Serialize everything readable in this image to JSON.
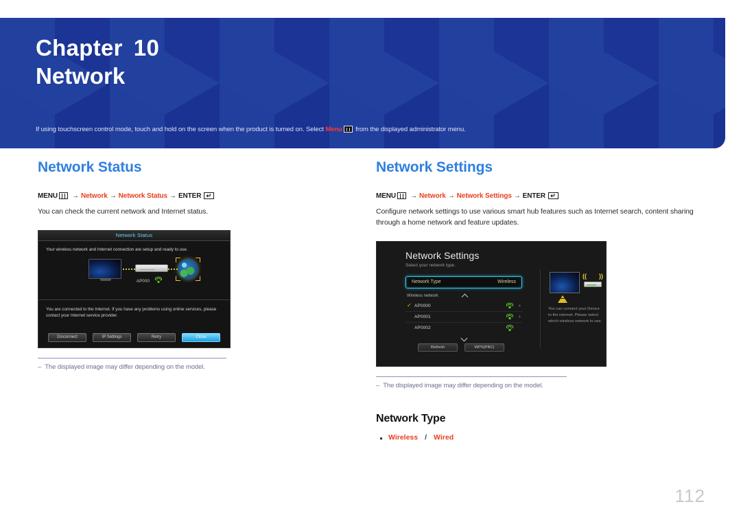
{
  "banner": {
    "chapter_word": "Chapter",
    "chapter_number": "10",
    "chapter_title": "Network",
    "note_before": "If using touchscreen control mode, touch and hold on the screen when the product is turned on. Select ",
    "note_keyword": "Menu",
    "note_after": " from the displayed administrator menu.",
    "bg_color": "#1f3a9e"
  },
  "left_section": {
    "title": "Network Status",
    "menu_path": {
      "menu_label": "MENU",
      "arrow": "→",
      "step1": "Network",
      "step2": "Network Status",
      "enter_label": "ENTER"
    },
    "description": "You can check the current network and Internet status.",
    "caption_dash": "–",
    "caption": "The displayed image may differ depending on the model.",
    "screenshot": {
      "title": "Network Status",
      "status_line": "Your wireless network and Internet connection are setup and ready to use.",
      "ap_label": "AP000",
      "message": "You are connected to the Internet. If you have any problems using online services, please contact your Internet service provider.",
      "buttons": [
        {
          "label": "Disconnect",
          "primary": false
        },
        {
          "label": "IP Settings",
          "primary": false
        },
        {
          "label": "Retry",
          "primary": false
        },
        {
          "label": "Close",
          "primary": true
        }
      ]
    }
  },
  "right_section": {
    "title": "Network Settings",
    "menu_path": {
      "menu_label": "MENU",
      "arrow": "→",
      "step1": "Network",
      "step2": "Network Settings",
      "enter_label": "ENTER"
    },
    "description": "Configure network settings to use various smart hub features such as Internet search, content sharing through a home network and feature updates.",
    "caption_dash": "–",
    "caption": "The displayed image may differ depending on the model.",
    "screenshot": {
      "title": "Network Settings",
      "subtitle": "Select your network type.",
      "network_type_label": "Network Type",
      "network_type_value": "Wireless",
      "wireless_network_label": "Wireless network",
      "ap_list": [
        {
          "name": "AP0000",
          "selected": true,
          "has_arrow": true
        },
        {
          "name": "AP0001",
          "selected": false,
          "has_arrow": true
        },
        {
          "name": "AP0002",
          "selected": false,
          "has_arrow": false
        }
      ],
      "buttons": [
        {
          "label": "Refresh"
        },
        {
          "label": "WPS(PBC)"
        }
      ],
      "side_text": "You can connect your Device to the internet. Please select which wireless network to use."
    },
    "subsection": {
      "title": "Network Type",
      "option_a": "Wireless",
      "separator": "/",
      "option_b": "Wired"
    }
  },
  "page_number": "112"
}
